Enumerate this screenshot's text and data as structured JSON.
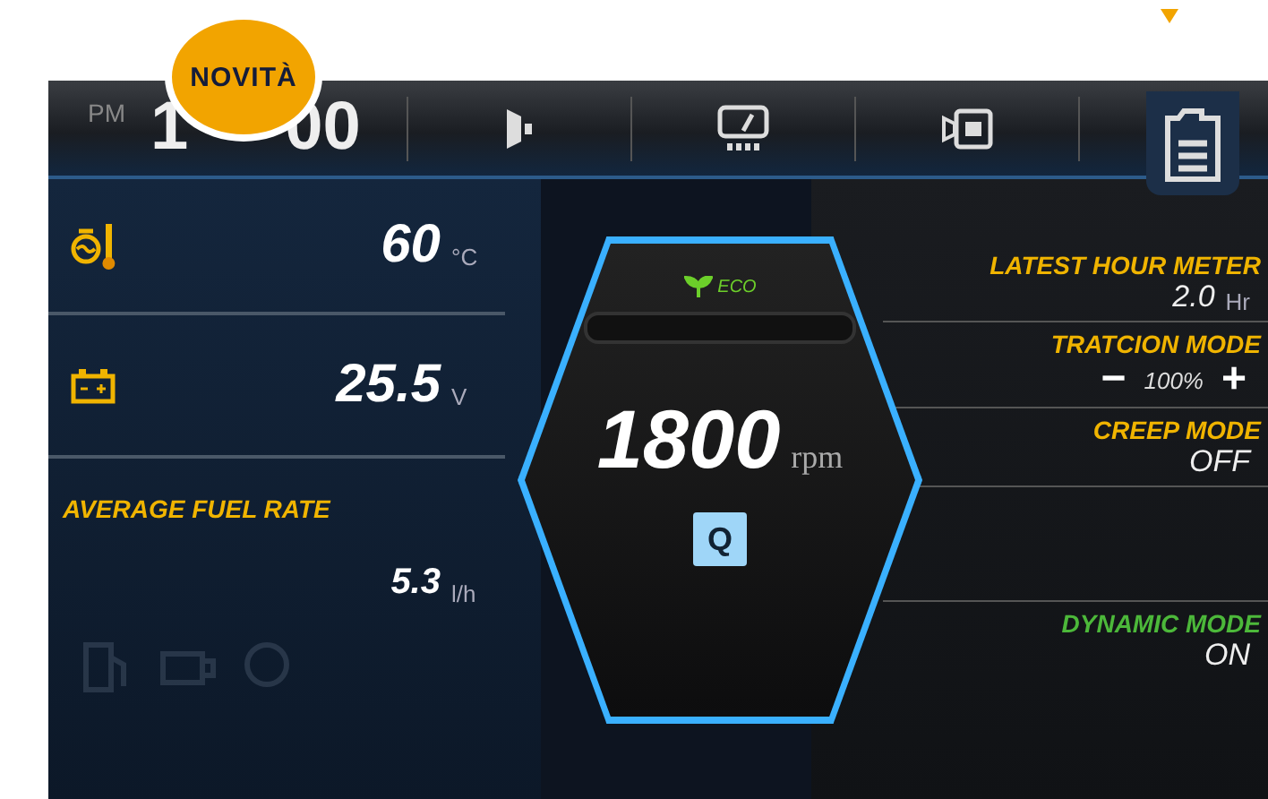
{
  "badge": "NOVITÀ",
  "top_bar": {
    "period": "PM",
    "clock_parts": [
      "1",
      "00"
    ]
  },
  "left_panel": {
    "readings": [
      {
        "kind": "temperature",
        "value": "60",
        "unit": "°C"
      },
      {
        "kind": "battery",
        "value": "25.5",
        "unit": "V"
      }
    ],
    "fuel_rate": {
      "label": "AVERAGE FUEL RATE",
      "value": "5.3",
      "unit": "l/h"
    }
  },
  "gauge": {
    "eco_label": "ECO",
    "value": "1800",
    "unit": "rpm",
    "mode_badge": "Q"
  },
  "right_panel": [
    {
      "kind": "value",
      "label": "LATEST HOUR METER",
      "color": "#f0b400",
      "value": "2.0",
      "unit": "Hr"
    },
    {
      "kind": "stepper",
      "label": "TRATCION MODE",
      "color": "#f0b400",
      "minus": "−",
      "value": "100%",
      "plus": "+"
    },
    {
      "kind": "value",
      "label": "CREEP MODE",
      "color": "#f0b400",
      "value": "OFF"
    },
    {
      "kind": "blank"
    },
    {
      "kind": "value",
      "label": "DYNAMIC MODE",
      "color": "#4cb83a",
      "value": "ON"
    }
  ]
}
